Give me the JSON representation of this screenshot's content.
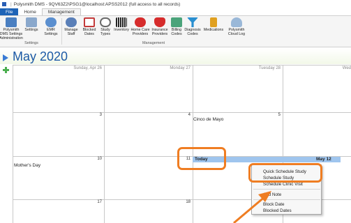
{
  "window": {
    "title": "Polysmith DMS - 9QV63Z2\\PSG1@localhost:APSS2012 (full access to all records)",
    "separator": "|"
  },
  "tabs": [
    {
      "label": "File"
    },
    {
      "label": "Home"
    },
    {
      "label": "Management"
    }
  ],
  "ribbon": {
    "buttons": [
      {
        "label": "Polysmith DMS Settings Administration",
        "icon": "admin-settings-icon",
        "color": "#4a7fc1"
      },
      {
        "label": "Settings",
        "icon": "settings-icon",
        "color": "#8aa8cc"
      },
      {
        "label": "EMR Settings",
        "icon": "emr-settings-icon",
        "color": "#5b8fcf"
      },
      {
        "label": "Manage Staff",
        "icon": "staff-icon",
        "color": "#5a7fb8"
      },
      {
        "label": "Blocked Dates",
        "icon": "calendar-block-icon",
        "color": "#c33a3a"
      },
      {
        "label": "Study Types",
        "icon": "globe-icon",
        "color": "#6a6a6a"
      },
      {
        "label": "Inventory",
        "icon": "barcode-icon",
        "color": "#222222"
      },
      {
        "label": "Home Care Providers",
        "icon": "home-care-icon",
        "color": "#d62c2c"
      },
      {
        "label": "Insurance Providers",
        "icon": "insurance-shield-icon",
        "color": "#d62c2c"
      },
      {
        "label": "Billing Codes",
        "icon": "billing-icon",
        "color": "#4aa37a"
      },
      {
        "label": "Diagnosis Codes",
        "icon": "diagnosis-icon",
        "color": "#2a8fd0"
      },
      {
        "label": "Medications",
        "icon": "medications-icon",
        "color": "#e0a020"
      },
      {
        "label": "Polysmith Cloud Log",
        "icon": "cloud-icon",
        "color": "#9ab8d8"
      }
    ],
    "groups": [
      {
        "label": "Settings"
      },
      {
        "label": "Management"
      }
    ]
  },
  "calendar": {
    "month_title": "May 2020",
    "day_headers": [
      "Sunday, Apr 26",
      "Monday 27",
      "Tuesday 28",
      "Wed"
    ],
    "week2": {
      "sun": "3",
      "mon": "4",
      "tue": "5"
    },
    "week3": {
      "sun": "10",
      "mon": "11",
      "tue": "12"
    },
    "week4": {
      "sun": "17",
      "mon": "18"
    },
    "events": {
      "cinco": "Cinco de Mayo",
      "mothers_day": "Mother's Day"
    },
    "today_label": "Today",
    "selected_date_label": "May 12"
  },
  "context_menu": {
    "items": [
      "Quick Schedule Study",
      "Schedule Study",
      "Schedule Clinic Visit",
      "Add Note",
      "Block Date",
      "Blocked Dates"
    ]
  },
  "colors": {
    "accent": "#1e63b6",
    "callout": "#ef7d22",
    "today_highlight": "#9fc5ee"
  }
}
